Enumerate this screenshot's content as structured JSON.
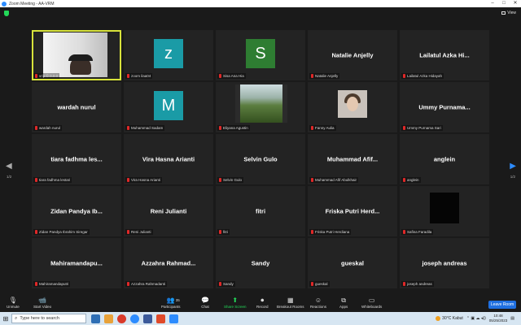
{
  "window": {
    "title": "Zoom Meeting - AA-VRM",
    "minimize": "–",
    "maximize": "□",
    "close": "✕"
  },
  "colors": {
    "accent": "#2d8cff",
    "active_speaker": "#d8e33b",
    "muted_mic": "#e02828",
    "share_green": "#23d959",
    "leave_button": "#1f6fe0"
  },
  "meeting": {
    "view_label": "View",
    "page_left": "1/2",
    "page_right": "1/2",
    "tiles": [
      {
        "name": "",
        "caption": "vrip © 0.0.0",
        "type": "video-self",
        "active": true
      },
      {
        "name": "",
        "caption": "zoom ilaa04",
        "type": "avatar",
        "letter": "z",
        "color": "#1a9ba6"
      },
      {
        "name": "",
        "caption": "Sisa Ana Hia",
        "type": "avatar",
        "letter": "S",
        "color": "#2e7d32"
      },
      {
        "name": "Natalie Anjelly",
        "caption": "Natalie Anjelly",
        "type": "name"
      },
      {
        "name": "Lailatul Azka Hi...",
        "caption": "Lailatul Azka Hidayah",
        "type": "name"
      },
      {
        "name": "wardah nurul",
        "caption": "wardah nurul",
        "type": "name"
      },
      {
        "name": "",
        "caption": "Muhammad Sadam",
        "type": "avatar",
        "letter": "M",
        "color": "#1a9ba6"
      },
      {
        "name": "",
        "caption": "Eliyana Agustin",
        "type": "video-scene"
      },
      {
        "name": "",
        "caption": "Fanny Aulia",
        "type": "photo-fanny"
      },
      {
        "name": "Ummy Purnama...",
        "caption": "Ummy Purnama Sari",
        "type": "name"
      },
      {
        "name": "tiara fadhma les...",
        "caption": "tiara fadhma lestari",
        "type": "name"
      },
      {
        "name": "Vira Hasna Arianti",
        "caption": "Vira Hasna Arianti",
        "type": "name"
      },
      {
        "name": "Selvin Gulo",
        "caption": "Selvin Gulo",
        "type": "name"
      },
      {
        "name": "Muhammad Afif...",
        "caption": "Muhammad Afif Abulkhair",
        "type": "name"
      },
      {
        "name": "anglein",
        "caption": "anglein",
        "type": "name"
      },
      {
        "name": "Zidan Pandya Ib...",
        "caption": "Zidan Pandya Ibrahim Siregar",
        "type": "name"
      },
      {
        "name": "Reni Julianti",
        "caption": "Reni Julianti",
        "type": "name"
      },
      {
        "name": "fitri",
        "caption": "fitri",
        "type": "name"
      },
      {
        "name": "Friska Putri Herd...",
        "caption": "Friska Putri Herdiana",
        "type": "name"
      },
      {
        "name": "",
        "caption": "Safina Faradila",
        "type": "photo-safina"
      },
      {
        "name": "Mahiramandapu...",
        "caption": "Mahiramandaputri",
        "type": "name"
      },
      {
        "name": "Azzahra Rahmad...",
        "caption": "Azzahra Rahmadanti",
        "type": "name"
      },
      {
        "name": "Sandy",
        "caption": "Sandy",
        "type": "name"
      },
      {
        "name": "gueskal",
        "caption": "gueskal",
        "type": "name"
      },
      {
        "name": "joseph andreas",
        "caption": "joseph andreas",
        "type": "name"
      }
    ]
  },
  "toolbar": {
    "unmute": "Unmute",
    "start_video": "Start Video",
    "participants": "Participants",
    "participants_count": "35",
    "chat": "Chat",
    "share_screen": "Share Screen",
    "record": "Record",
    "breakout_rooms": "Breakout Rooms",
    "reactions": "Reactions",
    "apps": "Apps",
    "whiteboards": "Whiteboards",
    "leave": "Leave Room"
  },
  "taskbar": {
    "search_placeholder": "Type here to search",
    "weather": "30°C Kabut",
    "time": "10:48",
    "date": "05/25/2023"
  }
}
